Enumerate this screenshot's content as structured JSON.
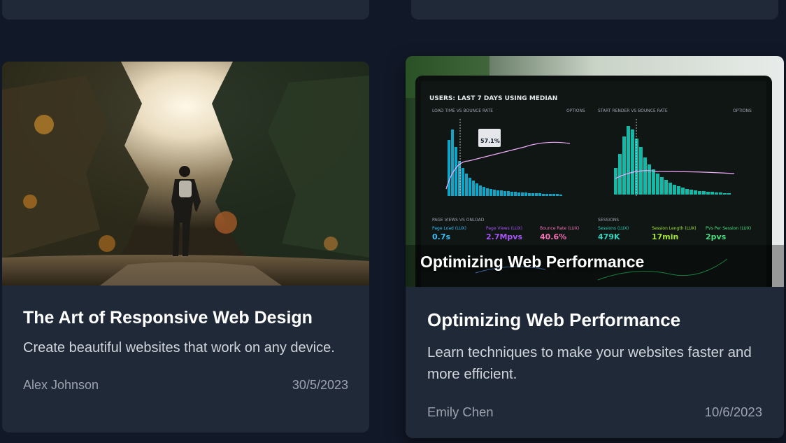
{
  "cards": [
    {
      "title": "The Art of Responsive Web Design",
      "description": "Create beautiful websites that work on any device.",
      "author": "Alex Johnson",
      "date": "30/5/2023"
    },
    {
      "title": "Optimizing Web Performance",
      "overlay_title": "Optimizing Web Performance",
      "description": "Learn techniques to make your websites faster and more efficient.",
      "author": "Emily Chen",
      "date": "10/6/2023"
    }
  ],
  "dashboard": {
    "header": "USERS: LAST 7 DAYS USING MEDIAN",
    "panel_left_title": "LOAD TIME VS BOUNCE RATE",
    "panel_right_title": "START RENDER VS BOUNCE RATE",
    "options_label": "OPTIONS",
    "tooltip_value": "57.1%",
    "metrics": [
      {
        "label": "Page Load (LUX)",
        "value": "0.7s",
        "color": "#38bdf8"
      },
      {
        "label": "Page Views (LUX)",
        "value": "2.7Mpvs",
        "color": "#a855f7"
      },
      {
        "label": "Bounce Rate (LUX)",
        "value": "40.6%",
        "color": "#f472b6"
      },
      {
        "label": "Sessions (LUX)",
        "value": "479K",
        "color": "#2dd4bf"
      },
      {
        "label": "Session Length (LUX)",
        "value": "17min",
        "color": "#a3e635"
      },
      {
        "label": "PVs Per Session (LUX)",
        "value": "2pvs",
        "color": "#4ade80"
      }
    ],
    "page_views_label": "PAGE VIEWS VS ONLOAD",
    "sessions_label": "SESSIONS"
  }
}
